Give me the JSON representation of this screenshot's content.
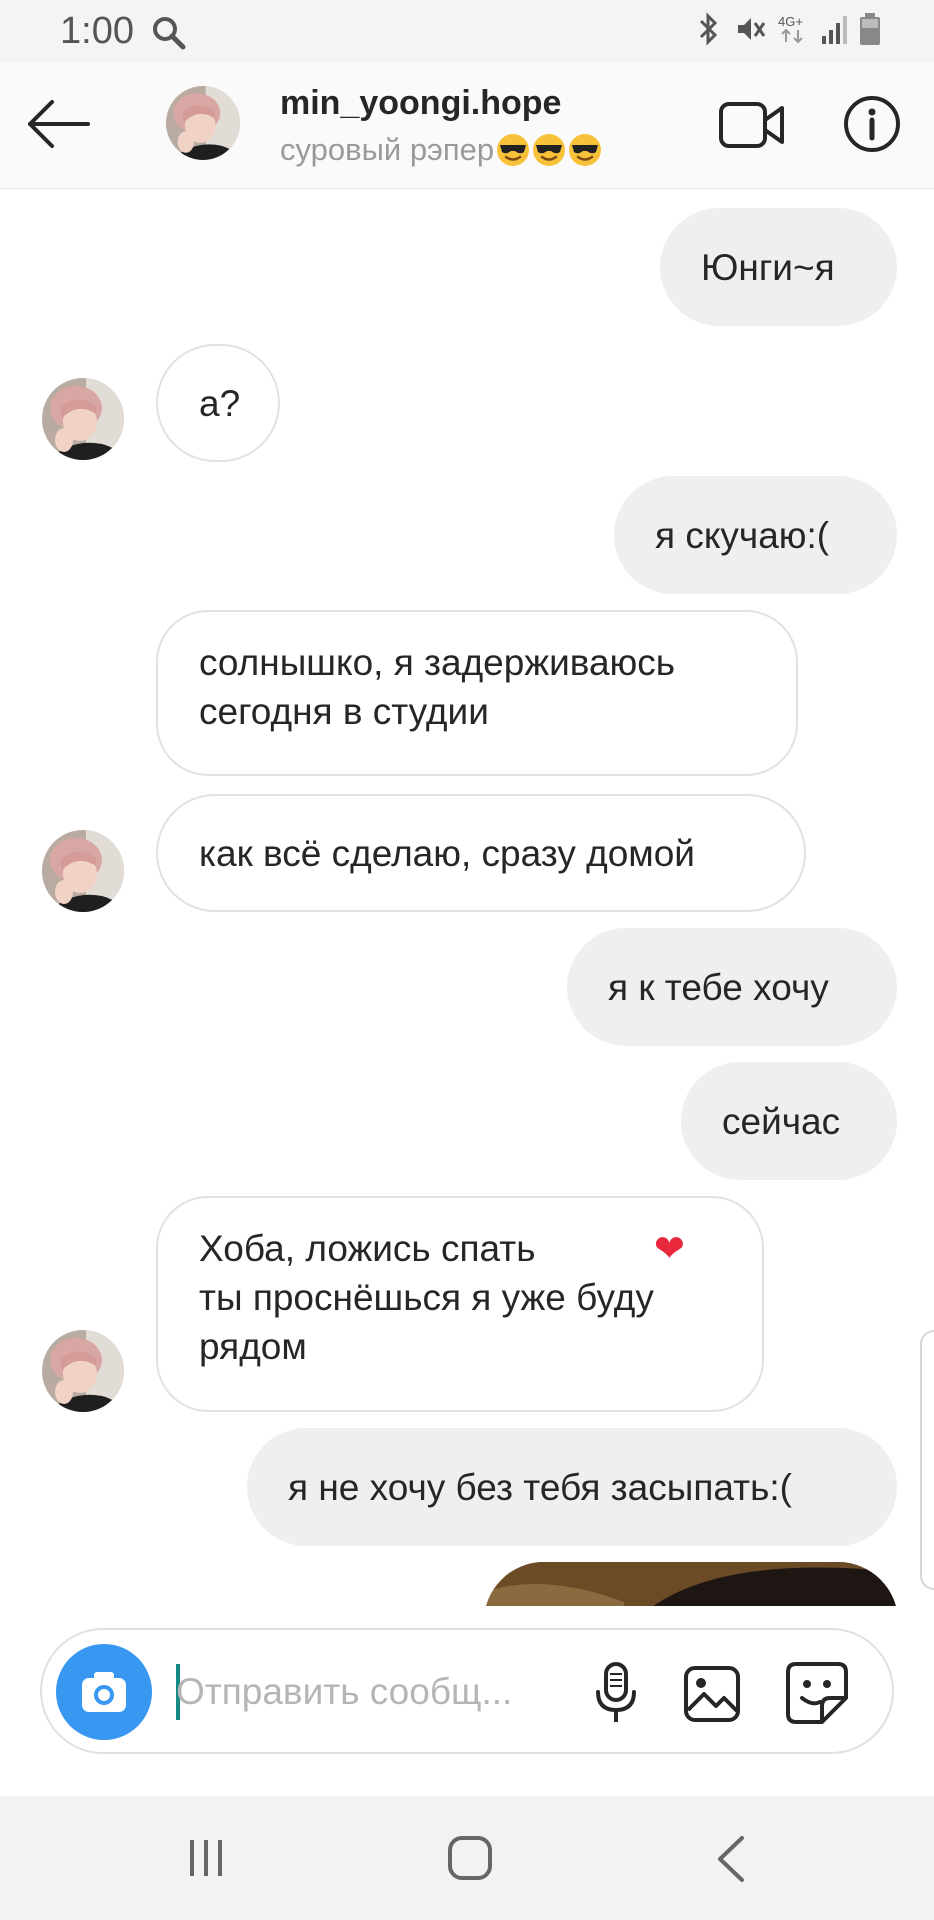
{
  "status_bar": {
    "time": "1:00",
    "network": "4G+"
  },
  "header": {
    "username": "min_yoongi.hope",
    "status": "суровый рэпер",
    "status_emoji": [
      "smiling-face-with-sunglasses",
      "smiling-face-with-sunglasses",
      "smiling-face-with-sunglasses"
    ]
  },
  "messages": [
    {
      "from": "me",
      "text": "Юнги~я"
    },
    {
      "from": "them",
      "text": "а?"
    },
    {
      "from": "me",
      "text": "я скучаю:("
    },
    {
      "from": "them",
      "text": "солнышко, я задерживаюсь\nсегодня в студии"
    },
    {
      "from": "them",
      "text": "как всё сделаю, сразу домой"
    },
    {
      "from": "me",
      "text": "я к тебе хочу"
    },
    {
      "from": "me",
      "text": "сейчас"
    },
    {
      "from": "them",
      "text": "Хоба, ложись спать\nты проснёшься я уже буду\nрядом❤"
    },
    {
      "from": "me",
      "text": "я не хочу без тебя засыпать:("
    },
    {
      "from": "me",
      "type": "photo"
    }
  ],
  "composer": {
    "placeholder": "Отправить сообщ..."
  },
  "colors": {
    "accent_blue": "#3897f0",
    "outgoing_bubble": "#efeff1",
    "incoming_border": "#e2e2e2",
    "heart_red": "#e8293b"
  }
}
